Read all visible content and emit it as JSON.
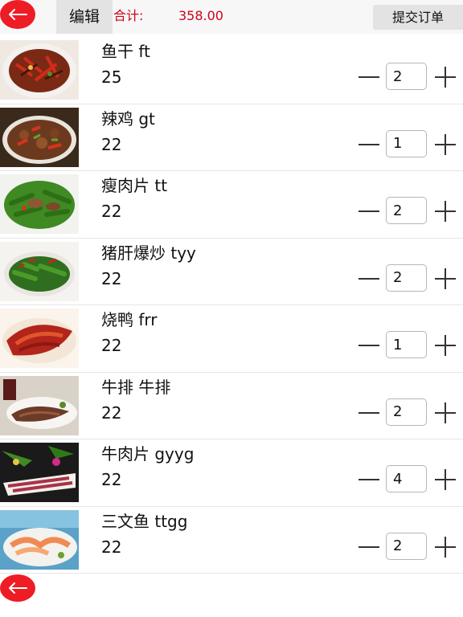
{
  "header": {
    "back_icon": "left-arrow-icon",
    "edit_label": "编辑",
    "total_label": "合计:",
    "total_value": "358.00",
    "submit_label": "提交订单",
    "accent_color": "#d0021b",
    "back_color": "#ee1c24"
  },
  "items": [
    {
      "name": "鱼干 ft",
      "price": "25",
      "qty": "2",
      "image": "dried-fish-with-chili-dish"
    },
    {
      "name": "辣鸡 gt",
      "price": "22",
      "qty": "1",
      "image": "spicy-chicken-dish"
    },
    {
      "name": "瘦肉片 tt",
      "price": "22",
      "qty": "2",
      "image": "pork-slices-with-green-pepper-dish"
    },
    {
      "name": "猪肝爆炒 tyy",
      "price": "22",
      "qty": "2",
      "image": "stir-fried-pork-liver-dish"
    },
    {
      "name": "烧鸭 frr",
      "price": "22",
      "qty": "1",
      "image": "roast-duck-dish"
    },
    {
      "name": "牛排 牛排",
      "price": "22",
      "qty": "2",
      "image": "steak-dish"
    },
    {
      "name": "牛肉片 gyyg",
      "price": "22",
      "qty": "4",
      "image": "beef-slices-platter"
    },
    {
      "name": "三文鱼 ttgg",
      "price": "22",
      "qty": "2",
      "image": "salmon-sashimi-platter"
    }
  ],
  "footer": {
    "back_icon": "left-arrow-icon"
  }
}
